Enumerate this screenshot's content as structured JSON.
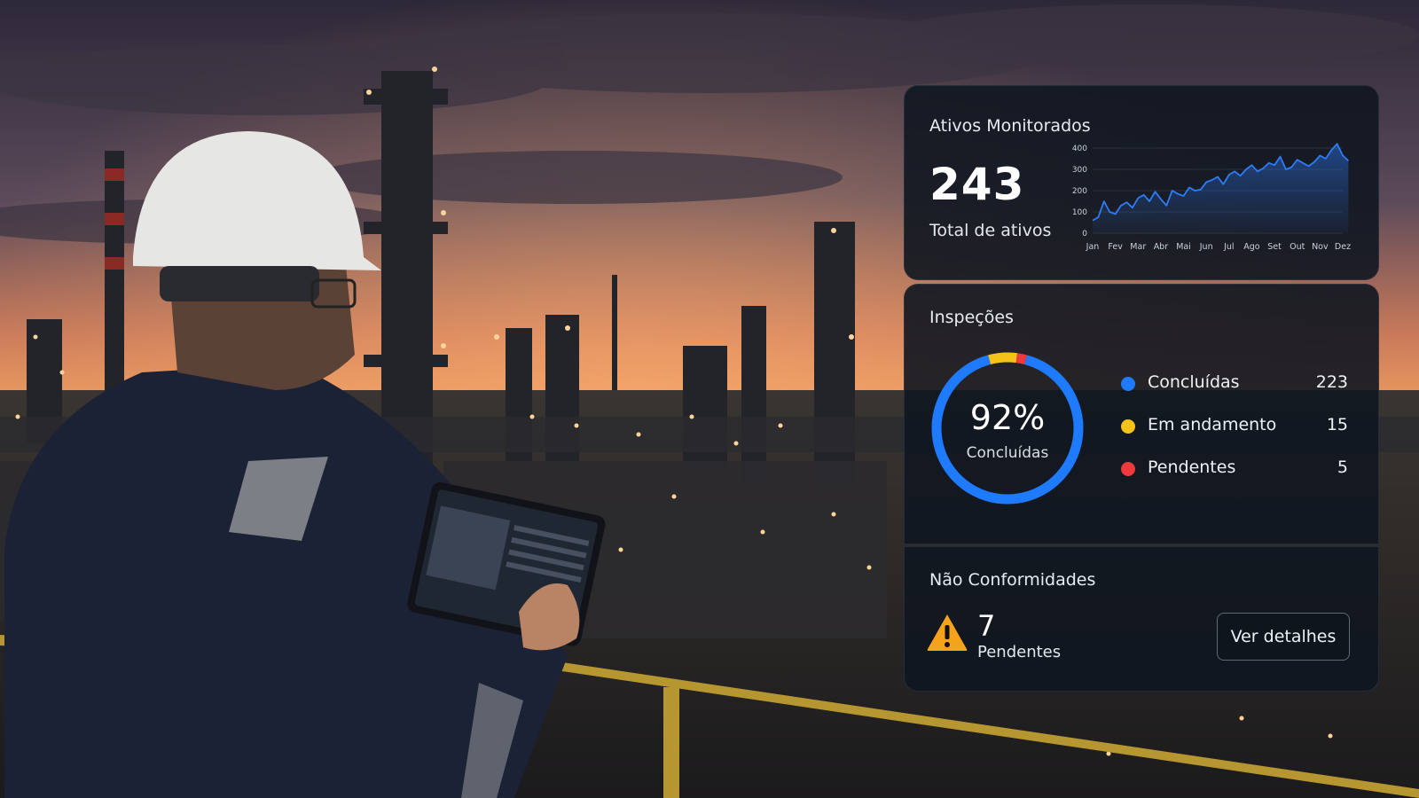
{
  "assets": {
    "title": "Ativos Monitorados",
    "total": "243",
    "caption": "Total de ativos"
  },
  "inspections": {
    "title": "Inspeções",
    "percent_label": "92%",
    "percent_caption": "Concluídas",
    "legend": [
      {
        "label": "Concluídas",
        "value": "223",
        "color": "#1e7bff"
      },
      {
        "label": "Em andamento",
        "value": "15",
        "color": "#f5c21b"
      },
      {
        "label": "Pendentes",
        "value": "5",
        "color": "#ee3a3a"
      }
    ]
  },
  "nonconformities": {
    "title": "Não Conformidades",
    "count": "7",
    "caption": "Pendentes",
    "button_label": "Ver detalhes",
    "icon": "warning-icon",
    "icon_color": "#f5a31a"
  },
  "chart_data": [
    {
      "type": "area",
      "title": "",
      "xlabel": "",
      "ylabel": "",
      "categories": [
        "Jan",
        "Fev",
        "Mar",
        "Abr",
        "Mai",
        "Jun",
        "Jul",
        "Ago",
        "Set",
        "Out",
        "Nov",
        "Dez"
      ],
      "x": [
        0,
        0.25,
        0.5,
        0.75,
        1,
        1.25,
        1.5,
        1.75,
        2,
        2.25,
        2.5,
        2.75,
        3,
        3.25,
        3.5,
        3.75,
        4,
        4.25,
        4.5,
        4.75,
        5,
        5.25,
        5.5,
        5.75,
        6,
        6.25,
        6.5,
        6.75,
        7,
        7.25,
        7.5,
        7.75,
        8,
        8.25,
        8.5,
        8.75,
        9,
        9.25,
        9.5,
        9.75,
        10,
        10.25,
        10.5,
        10.75,
        11,
        11.25
      ],
      "values": [
        60,
        75,
        150,
        100,
        90,
        130,
        145,
        120,
        165,
        180,
        150,
        195,
        160,
        130,
        200,
        185,
        175,
        215,
        200,
        205,
        240,
        250,
        265,
        230,
        275,
        290,
        270,
        300,
        320,
        290,
        305,
        330,
        320,
        360,
        300,
        310,
        345,
        330,
        315,
        335,
        365,
        350,
        390,
        420,
        365,
        340
      ],
      "ylim": [
        0,
        400
      ],
      "yticks": [
        0,
        100,
        200,
        300,
        400
      ],
      "grid": true,
      "color": "#2e7cf6"
    },
    {
      "type": "pie",
      "donut": true,
      "categories": [
        "Concluídas",
        "Em andamento",
        "Pendentes"
      ],
      "values": [
        223,
        15,
        5
      ],
      "colors": [
        "#1e7bff",
        "#f5c21b",
        "#ee3a3a"
      ]
    }
  ]
}
